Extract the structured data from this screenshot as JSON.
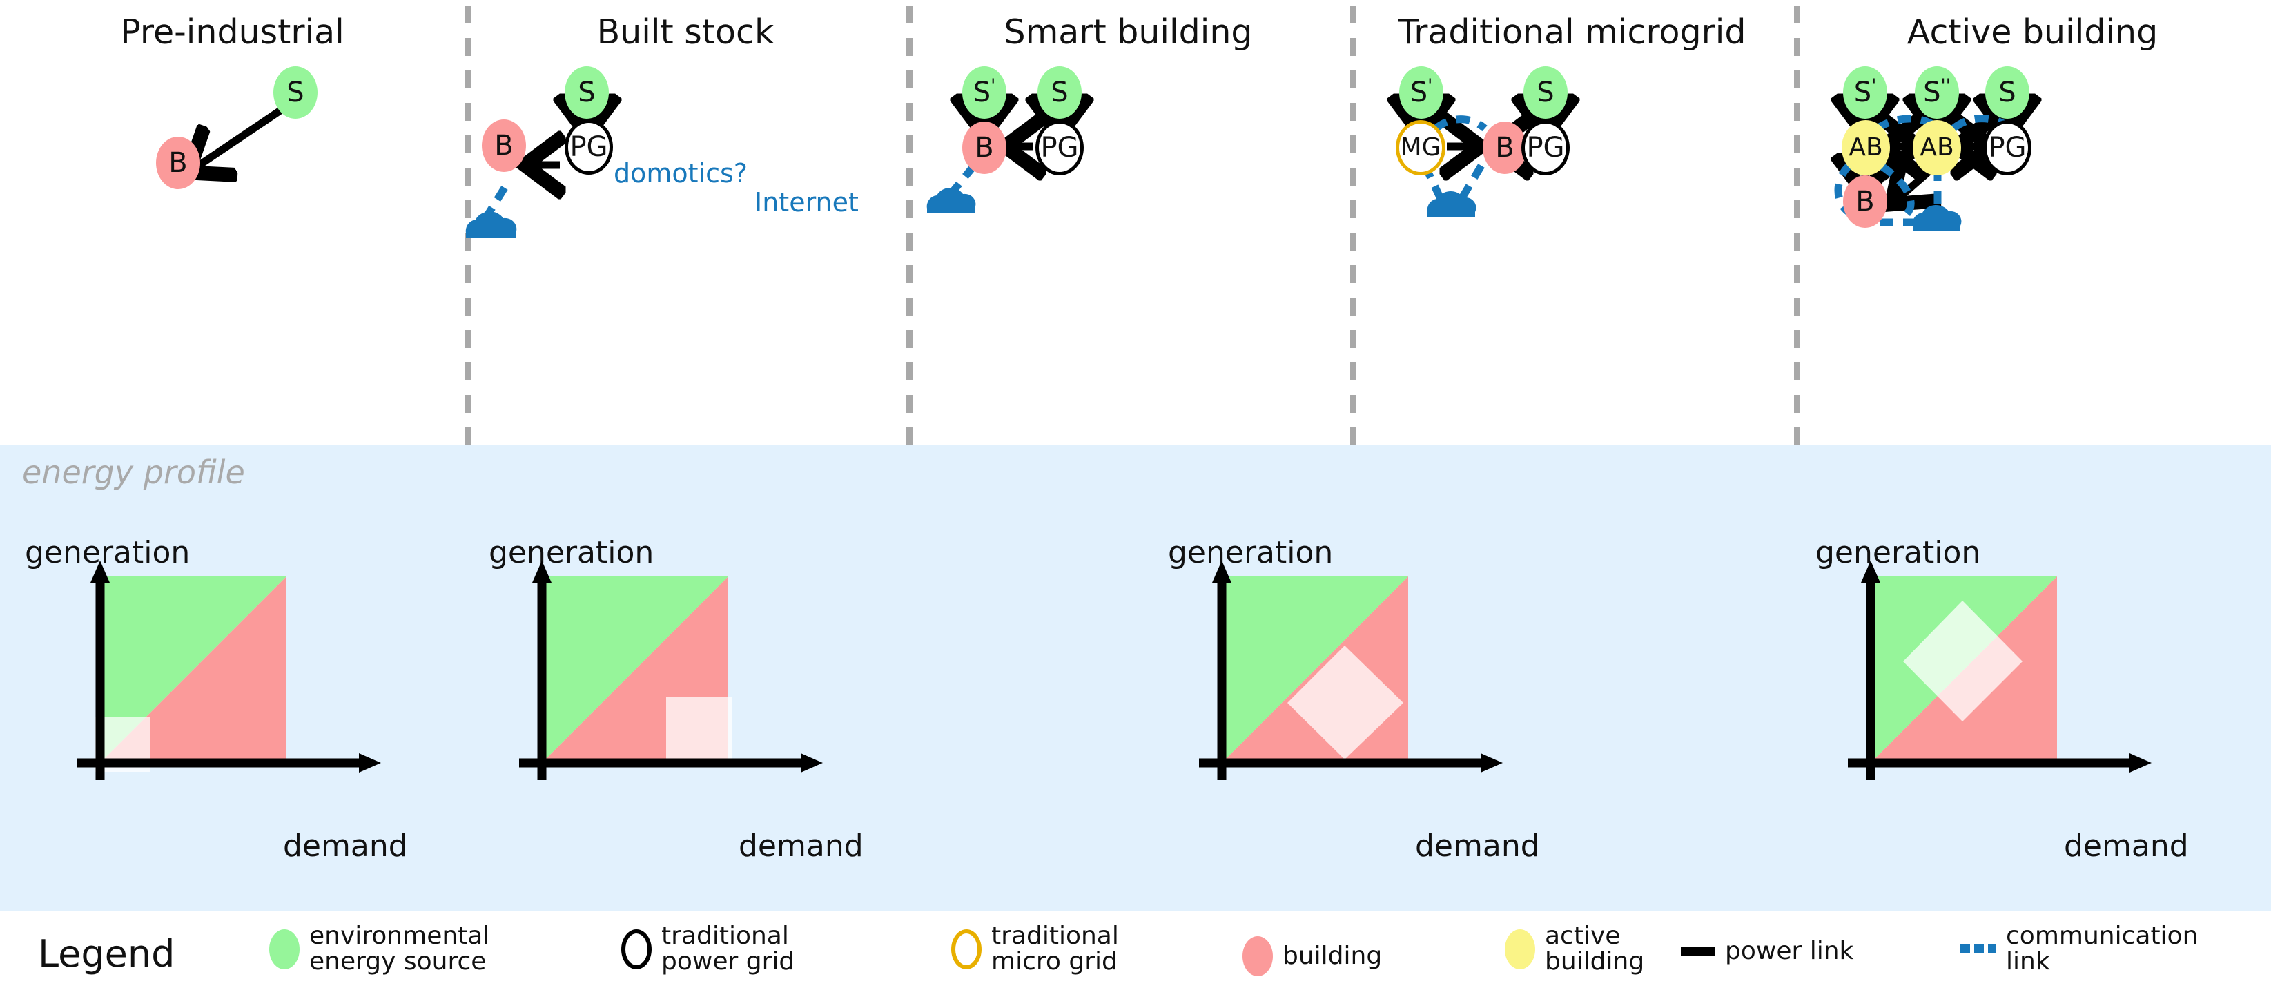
{
  "band": {
    "label": "energy profile"
  },
  "columns": [
    {
      "title": "Pre-industrial",
      "nodes": [
        {
          "id": "S",
          "label": "S",
          "type": "source"
        },
        {
          "id": "B",
          "label": "B",
          "type": "building"
        }
      ],
      "annotations": [],
      "profile": {
        "present": true,
        "ylabel": "generation",
        "xlabel": "demand",
        "highlight": "origin-square"
      }
    },
    {
      "title": "Built stock",
      "nodes": [
        {
          "id": "S",
          "label": "S",
          "type": "source"
        },
        {
          "id": "PG",
          "label": "PG",
          "type": "grid"
        },
        {
          "id": "B",
          "label": "B",
          "type": "building"
        }
      ],
      "annotations": [
        {
          "text": "domotics?"
        },
        {
          "text": "Internet"
        }
      ],
      "profile": {
        "present": true,
        "ylabel": "generation",
        "xlabel": "demand",
        "highlight": "bottom-right-square"
      }
    },
    {
      "title": "Smart building",
      "nodes": [
        {
          "id": "S1",
          "label": "S",
          "sup": "'",
          "type": "source"
        },
        {
          "id": "S",
          "label": "S",
          "type": "source"
        },
        {
          "id": "B",
          "label": "B",
          "type": "building"
        },
        {
          "id": "PG",
          "label": "PG",
          "type": "grid"
        }
      ],
      "annotations": [],
      "profile": {
        "present": false
      }
    },
    {
      "title": "Traditional microgrid",
      "nodes": [
        {
          "id": "S1",
          "label": "S",
          "sup": "'",
          "type": "source"
        },
        {
          "id": "S",
          "label": "S",
          "type": "source"
        },
        {
          "id": "MG",
          "label": "MG",
          "type": "micro"
        },
        {
          "id": "B",
          "label": "B",
          "type": "building"
        },
        {
          "id": "PG",
          "label": "PG",
          "type": "grid"
        }
      ],
      "annotations": [],
      "profile": {
        "present": true,
        "ylabel": "generation",
        "xlabel": "demand",
        "highlight": "diagonal-diamond"
      }
    },
    {
      "title": "Active building",
      "nodes": [
        {
          "id": "S1",
          "label": "S",
          "sup": "'",
          "type": "source"
        },
        {
          "id": "S2",
          "label": "S",
          "sup": "''",
          "type": "source"
        },
        {
          "id": "S",
          "label": "S",
          "type": "source"
        },
        {
          "id": "AB1",
          "label": "AB",
          "type": "active"
        },
        {
          "id": "AB2",
          "label": "AB",
          "type": "active"
        },
        {
          "id": "PG",
          "label": "PG",
          "type": "grid"
        },
        {
          "id": "B",
          "label": "B",
          "type": "building"
        }
      ],
      "annotations": [],
      "profile": {
        "present": true,
        "ylabel": "generation",
        "xlabel": "demand",
        "highlight": "green-diamond"
      }
    }
  ],
  "legend": {
    "title": "Legend",
    "items": [
      {
        "swatch": "green-ellipse",
        "label": "environmental\nenergy source"
      },
      {
        "swatch": "black-circle",
        "label": "traditional\npower grid"
      },
      {
        "swatch": "gold-circle",
        "label": "traditional\nmicro grid"
      },
      {
        "swatch": "red-ellipse",
        "label": "building"
      },
      {
        "swatch": "yellow-ellipse",
        "label": "active\nbuilding"
      },
      {
        "swatch": "solid-line",
        "label": "power link"
      },
      {
        "swatch": "dashed-line",
        "label": "communication\nlink"
      }
    ]
  },
  "chart_data": {
    "type": "area",
    "title": "energy profile",
    "xlabel": "demand",
    "ylabel": "generation",
    "regions": [
      {
        "name": "generation-dominant",
        "color": "#96f59a",
        "where": "above diagonal"
      },
      {
        "name": "demand-dominant",
        "color": "#fb9a9a",
        "where": "below diagonal"
      }
    ],
    "panels": [
      {
        "column": "Pre-industrial",
        "highlight": "square at origin",
        "operating_range": [
          0.0,
          0.28
        ]
      },
      {
        "column": "Built stock",
        "highlight": "square at bottom-right",
        "operating_range": [
          0.62,
          1.0
        ]
      },
      {
        "column": "Smart building",
        "highlight": "none",
        "operating_range": null
      },
      {
        "column": "Traditional microgrid",
        "highlight": "diamond centred on diagonal",
        "operating_range": [
          0.45,
          0.85
        ]
      },
      {
        "column": "Active building",
        "highlight": "diamond in generation region",
        "operating_range": [
          0.18,
          0.62
        ]
      }
    ]
  },
  "colors": {
    "source": "#96f59a",
    "building": "#fb9a9a",
    "active_building": "#faf487",
    "power_grid_stroke": "#000000",
    "micro_grid_stroke": "#e8af00",
    "communication_link": "#1878bb",
    "band_background": "#e2f1fd",
    "separator": "#a8a8a8",
    "band_label": "#a9a9a9"
  }
}
